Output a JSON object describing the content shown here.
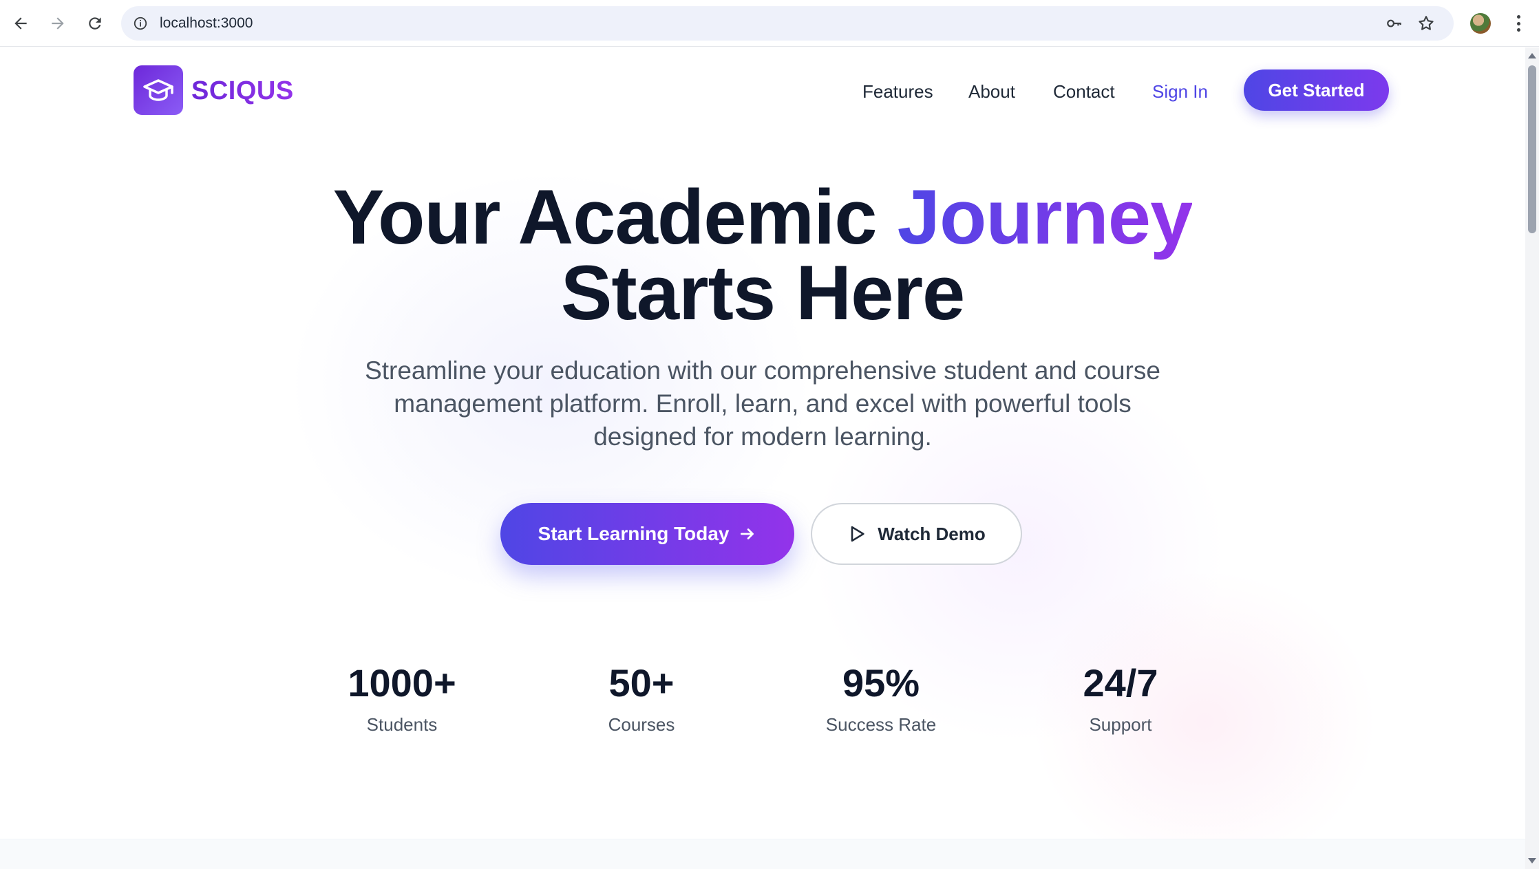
{
  "browser": {
    "url": "localhost:3000"
  },
  "header": {
    "logo_text": "SCIQUS",
    "nav": [
      "Features",
      "About",
      "Contact"
    ],
    "sign_in": "Sign In",
    "get_started": "Get Started"
  },
  "hero": {
    "title_part1": "Your Academic ",
    "title_accent": "Journey",
    "title_line2": "Starts Here",
    "subtitle": "Streamline your education with our comprehensive student and course management platform. Enroll, learn, and excel with powerful tools designed for modern learning.",
    "primary_cta": "Start Learning Today",
    "secondary_cta": "Watch Demo"
  },
  "stats": [
    {
      "value": "1000+",
      "label": "Students"
    },
    {
      "value": "50+",
      "label": "Courses"
    },
    {
      "value": "95%",
      "label": "Success Rate"
    },
    {
      "value": "24/7",
      "label": "Support"
    }
  ],
  "colors": {
    "brand": "#6d28d9",
    "accent_start": "#4f46e5",
    "accent_end": "#9333ea"
  }
}
